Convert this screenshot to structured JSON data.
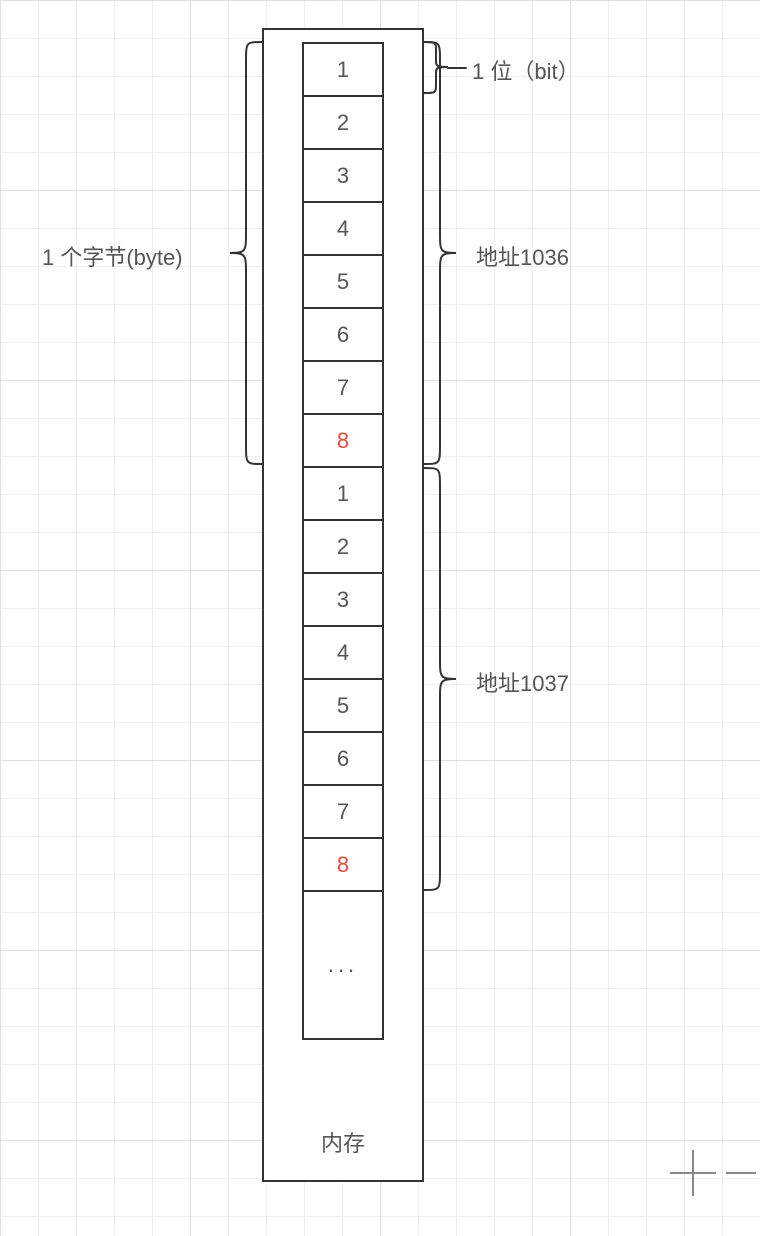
{
  "labels": {
    "byte": "1 个字节(byte)",
    "bit": "1 位（bit）",
    "addr1": "地址1036",
    "addr2": "地址1037",
    "memory": "内存",
    "ellipsis": "..."
  },
  "bytes": [
    {
      "bits": [
        "1",
        "2",
        "3",
        "4",
        "5",
        "6",
        "7",
        "8"
      ],
      "address": "1036"
    },
    {
      "bits": [
        "1",
        "2",
        "3",
        "4",
        "5",
        "6",
        "7",
        "8"
      ],
      "address": "1037"
    }
  ],
  "chart_data": {
    "type": "diagram",
    "description": "Memory layout showing two consecutive bytes at addresses 1036 and 1037; each byte has 8 bits numbered 1–8. The 8th bit of each byte is highlighted in red.",
    "bits_per_byte": 8,
    "bytes": [
      {
        "address": 1036,
        "bits": [
          1,
          2,
          3,
          4,
          5,
          6,
          7,
          8
        ]
      },
      {
        "address": 1037,
        "bits": [
          1,
          2,
          3,
          4,
          5,
          6,
          7,
          8
        ]
      }
    ],
    "title": "内存"
  }
}
